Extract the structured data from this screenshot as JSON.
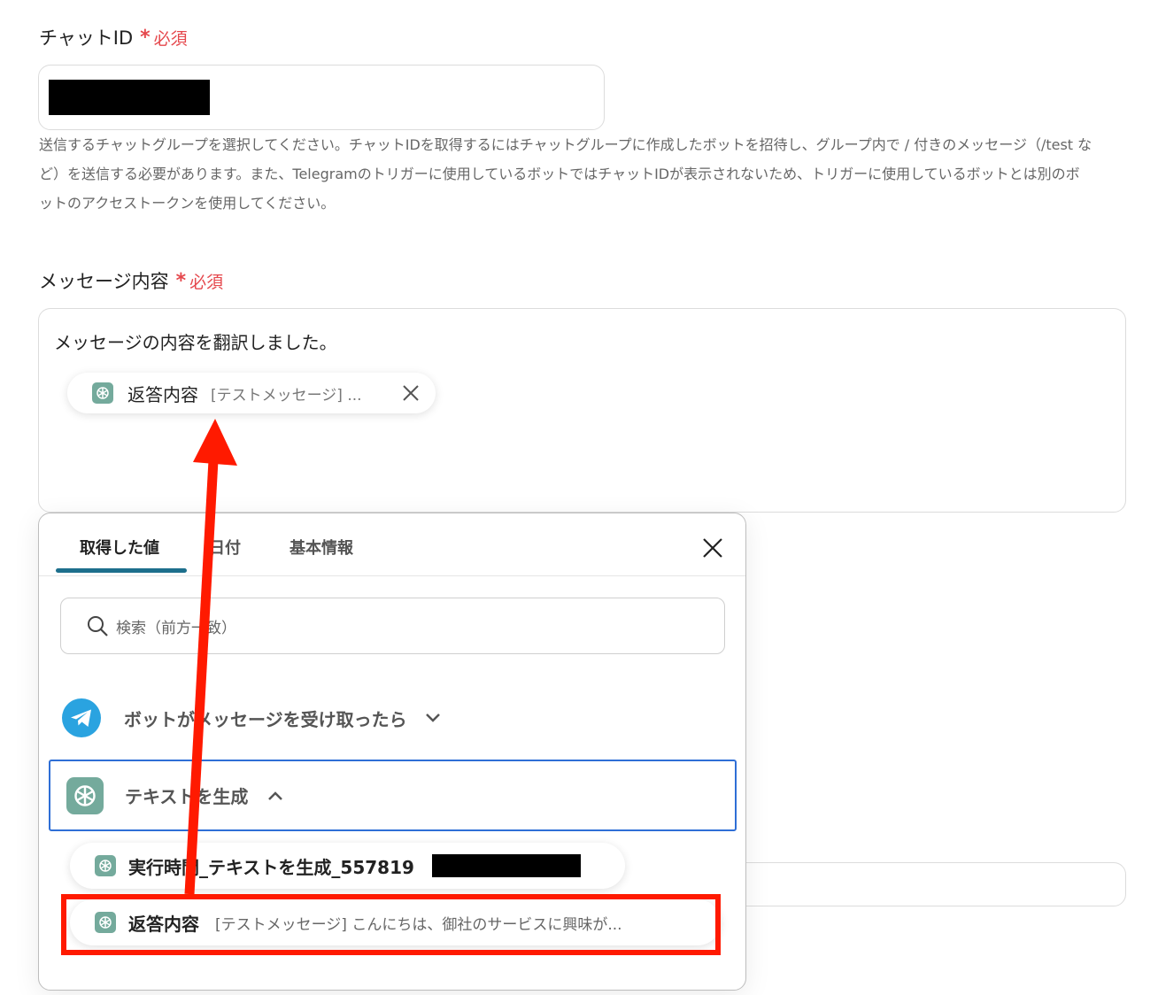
{
  "chat_id": {
    "label": "チャットID",
    "required_mark": "*",
    "required_label": "必須",
    "help_lines": [
      "送信するチャットグループを選択してください。チャットIDを取得するにはチャットグループに作成したボットを招待し、グループ内で / 付きのメッセージ（/test な",
      "ど）を送信する必要があります。また、Telegramのトリガーに使用しているボットではチャットIDが表示されないため、トリガーに使用しているボットとは別のボ",
      "ットのアクセストークンを使用してください。"
    ]
  },
  "message": {
    "label": "メッセージ内容",
    "required_mark": "*",
    "required_label": "必須",
    "text": "メッセージの内容を翻訳しました。",
    "token": {
      "name": "返答内容",
      "preview": "[テストメッセージ] ...",
      "icon": "chatgpt-icon"
    }
  },
  "picker": {
    "tabs": [
      {
        "label": "取得した値",
        "active": true
      },
      {
        "label": "日付",
        "active": false
      },
      {
        "label": "基本情報",
        "active": false
      }
    ],
    "search_placeholder": "検索（前方一致）",
    "groups": [
      {
        "title": "ボットがメッセージを受け取ったら",
        "icon": "telegram-icon",
        "expanded": false
      },
      {
        "title": "テキストを生成",
        "icon": "chatgpt-icon",
        "expanded": true
      }
    ],
    "items": [
      {
        "label": "実行時間_テキストを生成_557819",
        "value": "",
        "icon": "chatgpt-icon"
      },
      {
        "label": "返答内容",
        "value": "[テストメッセージ] こんにちは、御社のサービスに興味が...",
        "icon": "chatgpt-icon",
        "highlighted": true
      }
    ]
  },
  "colors": {
    "required": "#e5484d",
    "tab_underline": "#1d6f8c",
    "group_border": "#2f6fd6",
    "annotation": "#ff1a00",
    "telegram": "#2aa3e0",
    "chatgpt_bg": "#74aa9c"
  }
}
